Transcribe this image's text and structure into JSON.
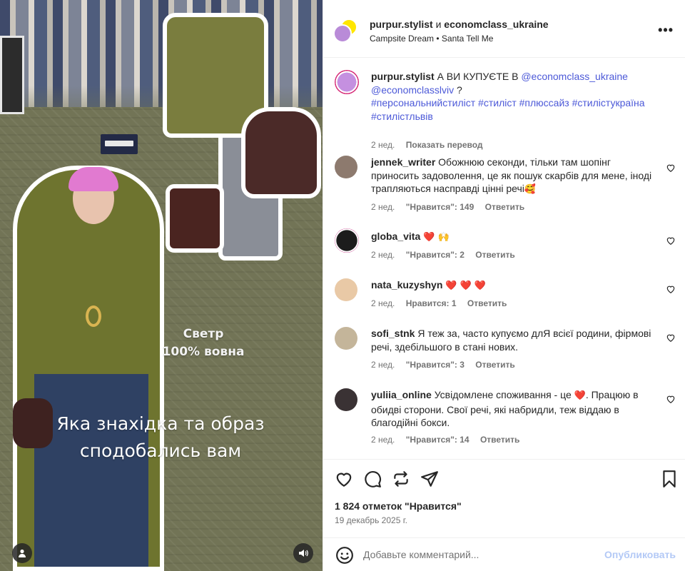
{
  "media": {
    "label_svetr_line1": "Светр",
    "label_svetr_line2": "100% вовна",
    "question_line1": "Яка знахідка та образ",
    "question_line2": "сподобались вам",
    "user_icon": "user-icon",
    "sound_icon": "speaker-icon"
  },
  "header": {
    "user1": "purpur.stylist",
    "joiner": "и",
    "user2": "economclass_ukraine",
    "audio": "Campsite Dream • Santa Tell Me",
    "more_label": "•••"
  },
  "caption": {
    "user": "purpur.stylist",
    "text": "А ВИ КУПУЄТЕ В",
    "mention1": "@economclass_ukraine",
    "mention2": "@economclasslviv",
    "text_end": "?",
    "hashtags": "#персональнийстиліст #стиліст #плюссайз #стилістукраїна #стилістльвів",
    "time": "2 нед.",
    "translate": "Показать перевод"
  },
  "comments": [
    {
      "user": "jennek_writer",
      "text": "Обожнюю секонди, тільки там шопінг приносить задоволення, це як пошук скарбів для мене, іноді трапляються насправді цінні речі",
      "emoji": "🥰",
      "time": "2 нед.",
      "likes": "\"Нравится\": 149",
      "reply": "Ответить"
    },
    {
      "user": "globa_vita",
      "text": "",
      "emoji": "❤️ 🙌",
      "time": "2 нед.",
      "likes": "\"Нравится\": 2",
      "reply": "Ответить"
    },
    {
      "user": "nata_kuzyshyn",
      "text": "",
      "emoji": "❤️ ❤️ ❤️",
      "time": "2 нед.",
      "likes": "Нравится: 1",
      "reply": "Ответить"
    },
    {
      "user": "sofi_stnk",
      "text": "Я теж за, часто купуємо длЯ всієї родини, фірмові речі, здебільшого в стані нових.",
      "emoji": "",
      "time": "2 нед.",
      "likes": "\"Нравится\": 3",
      "reply": "Ответить"
    },
    {
      "user": "yuliia_online",
      "text_before": "Усвідомлене споживання - це",
      "emoji": "❤️",
      "text_after": ". Працюю в обидві сторони. Свої речі, які набридли, теж віддаю в благодійні бокси.",
      "time": "2 нед.",
      "likes": "\"Нравится\": 14",
      "reply": "Ответить"
    }
  ],
  "actions": {
    "likes": "1 824 отметок \"Нравится\"",
    "date": "19 декабрь 2025 г.",
    "icons": [
      "heart-icon",
      "comment-icon",
      "repost-icon",
      "share-icon",
      "bookmark-icon"
    ]
  },
  "composer": {
    "placeholder": "Добавьте комментарий...",
    "publish": "Опубликовать",
    "emoji_icon": "smiley-icon"
  },
  "colors": {
    "link": "#4c59d8",
    "muted": "#737373",
    "publish_disabled": "#b3c9f6",
    "heart": "#ff3040"
  }
}
